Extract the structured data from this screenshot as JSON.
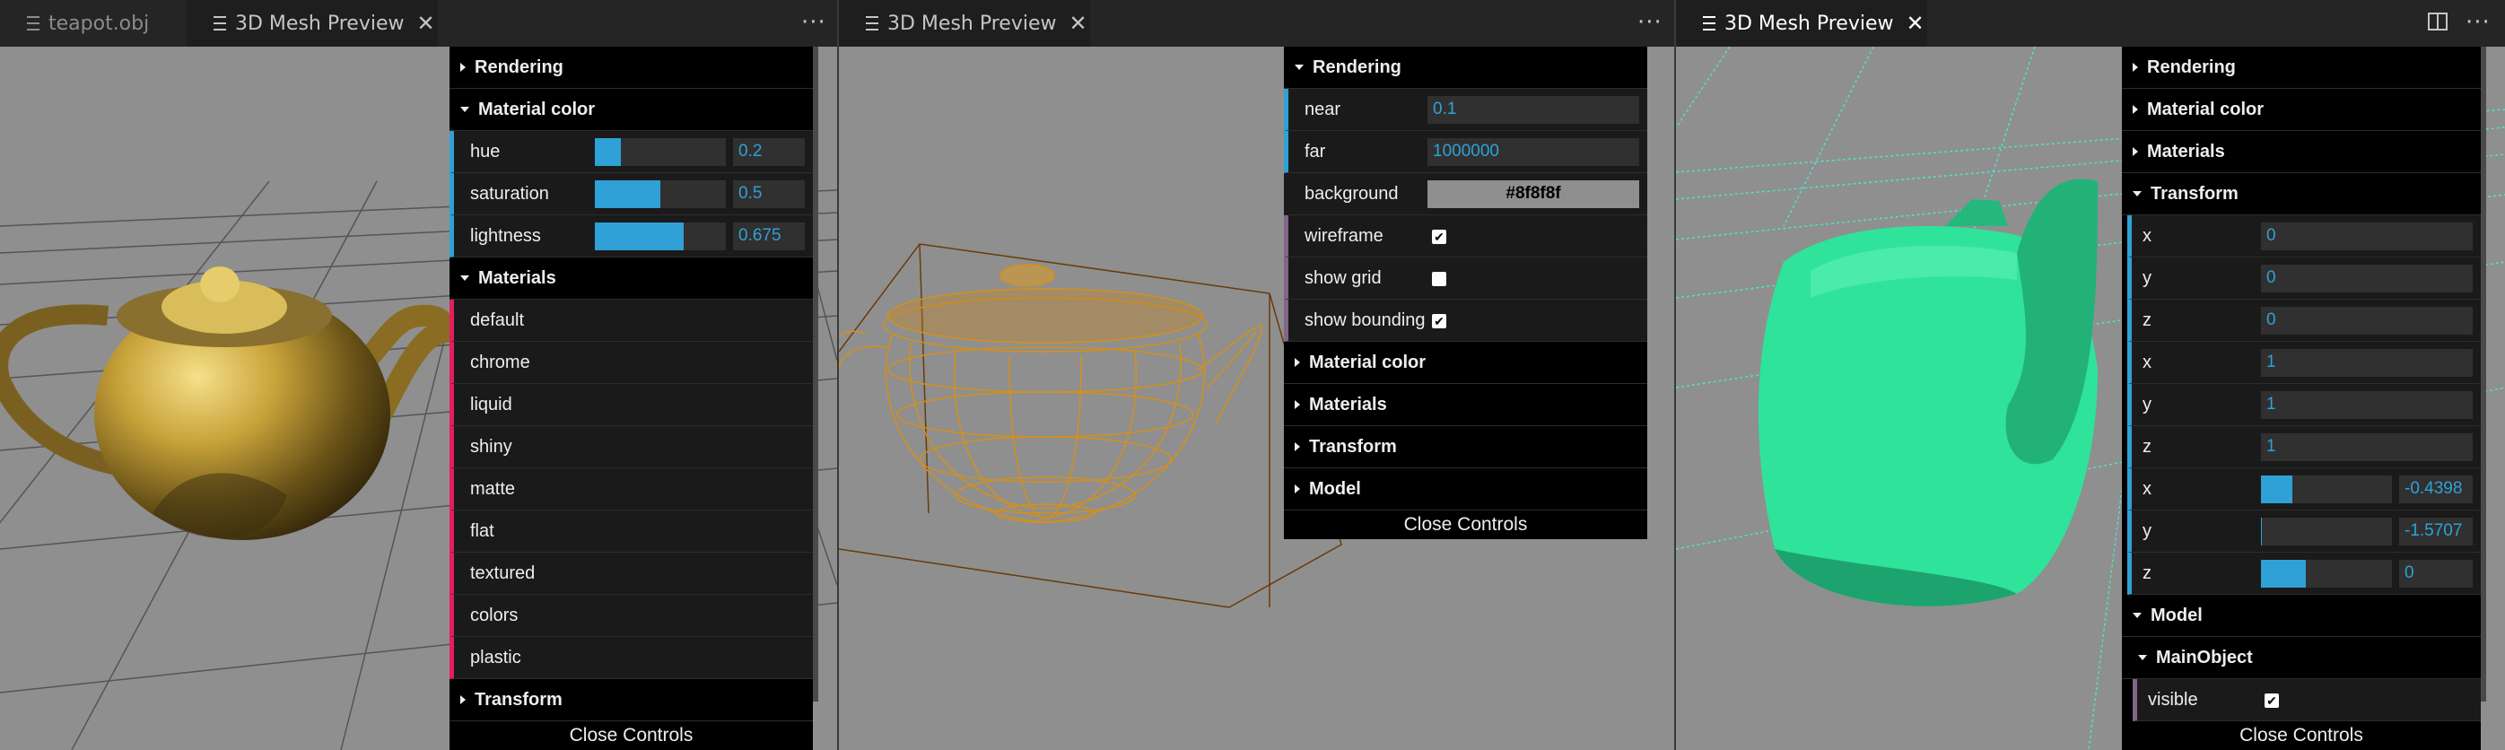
{
  "pane1": {
    "tabs": [
      {
        "label": "teapot.obj",
        "close": ""
      },
      {
        "label": "3D Mesh Preview",
        "close": "✕"
      }
    ],
    "more": "···",
    "gui": {
      "rendering": "Rendering",
      "material_color": "Material color",
      "hue_label": "hue",
      "hue_value": "0.2",
      "hue": 0.2,
      "saturation_label": "saturation",
      "saturation_value": "0.5",
      "saturation": 0.5,
      "lightness_label": "lightness",
      "lightness_value": "0.675",
      "lightness": 0.675,
      "materials": "Materials",
      "material_items": [
        "default",
        "chrome",
        "liquid",
        "shiny",
        "matte",
        "flat",
        "textured",
        "colors",
        "plastic"
      ],
      "transform": "Transform",
      "close_controls": "Close Controls"
    }
  },
  "pane2": {
    "tab": {
      "label": "3D Mesh Preview",
      "close": "✕"
    },
    "more": "···",
    "gui": {
      "rendering": "Rendering",
      "near_label": "near",
      "near_value": "0.1",
      "far_label": "far",
      "far_value": "1000000",
      "background_label": "background",
      "background_value": "#8f8f8f",
      "wireframe_label": "wireframe",
      "wireframe": "✔",
      "show_grid_label": "show grid",
      "show_grid": "",
      "show_bounding_label": "show bounding",
      "show_bounding": "✔",
      "material_color": "Material color",
      "materials": "Materials",
      "transform": "Transform",
      "model": "Model",
      "close_controls": "Close Controls"
    }
  },
  "pane3": {
    "tab": {
      "label": "3D Mesh Preview",
      "close": "✕"
    },
    "gui": {
      "rendering": "Rendering",
      "material_color": "Material color",
      "materials": "Materials",
      "transform": "Transform",
      "pos": [
        {
          "label": "x",
          "value": "0"
        },
        {
          "label": "y",
          "value": "0"
        },
        {
          "label": "z",
          "value": "0"
        }
      ],
      "scale": [
        {
          "label": "x",
          "value": "1"
        },
        {
          "label": "y",
          "value": "1"
        },
        {
          "label": "z",
          "value": "1"
        }
      ],
      "rot": [
        {
          "label": "x",
          "value": "-0.4398",
          "fraction": 0.24
        },
        {
          "label": "y",
          "value": "-1.5707",
          "fraction": 0.01
        },
        {
          "label": "z",
          "value": "0",
          "fraction": 0.34
        }
      ],
      "model": "Model",
      "main_object": "MainObject",
      "visible_label": "visible",
      "visible": "✔",
      "close_controls": "Close Controls"
    }
  },
  "colors": {
    "viewport_bg": "#8f8f8f",
    "number_accent": "#2fa1d6",
    "function_accent": "#e61d5f",
    "boolean_accent": "#806787",
    "gold_teapot": "#c9a33a",
    "wireframe": "#d4901a",
    "green_teapot": "#2fe39a",
    "cyan_grid": "#4fe3c8"
  },
  "icons": [
    "file-icon",
    "close-icon",
    "more-actions-icon",
    "split-editor-icon",
    "checkbox-icon"
  ]
}
